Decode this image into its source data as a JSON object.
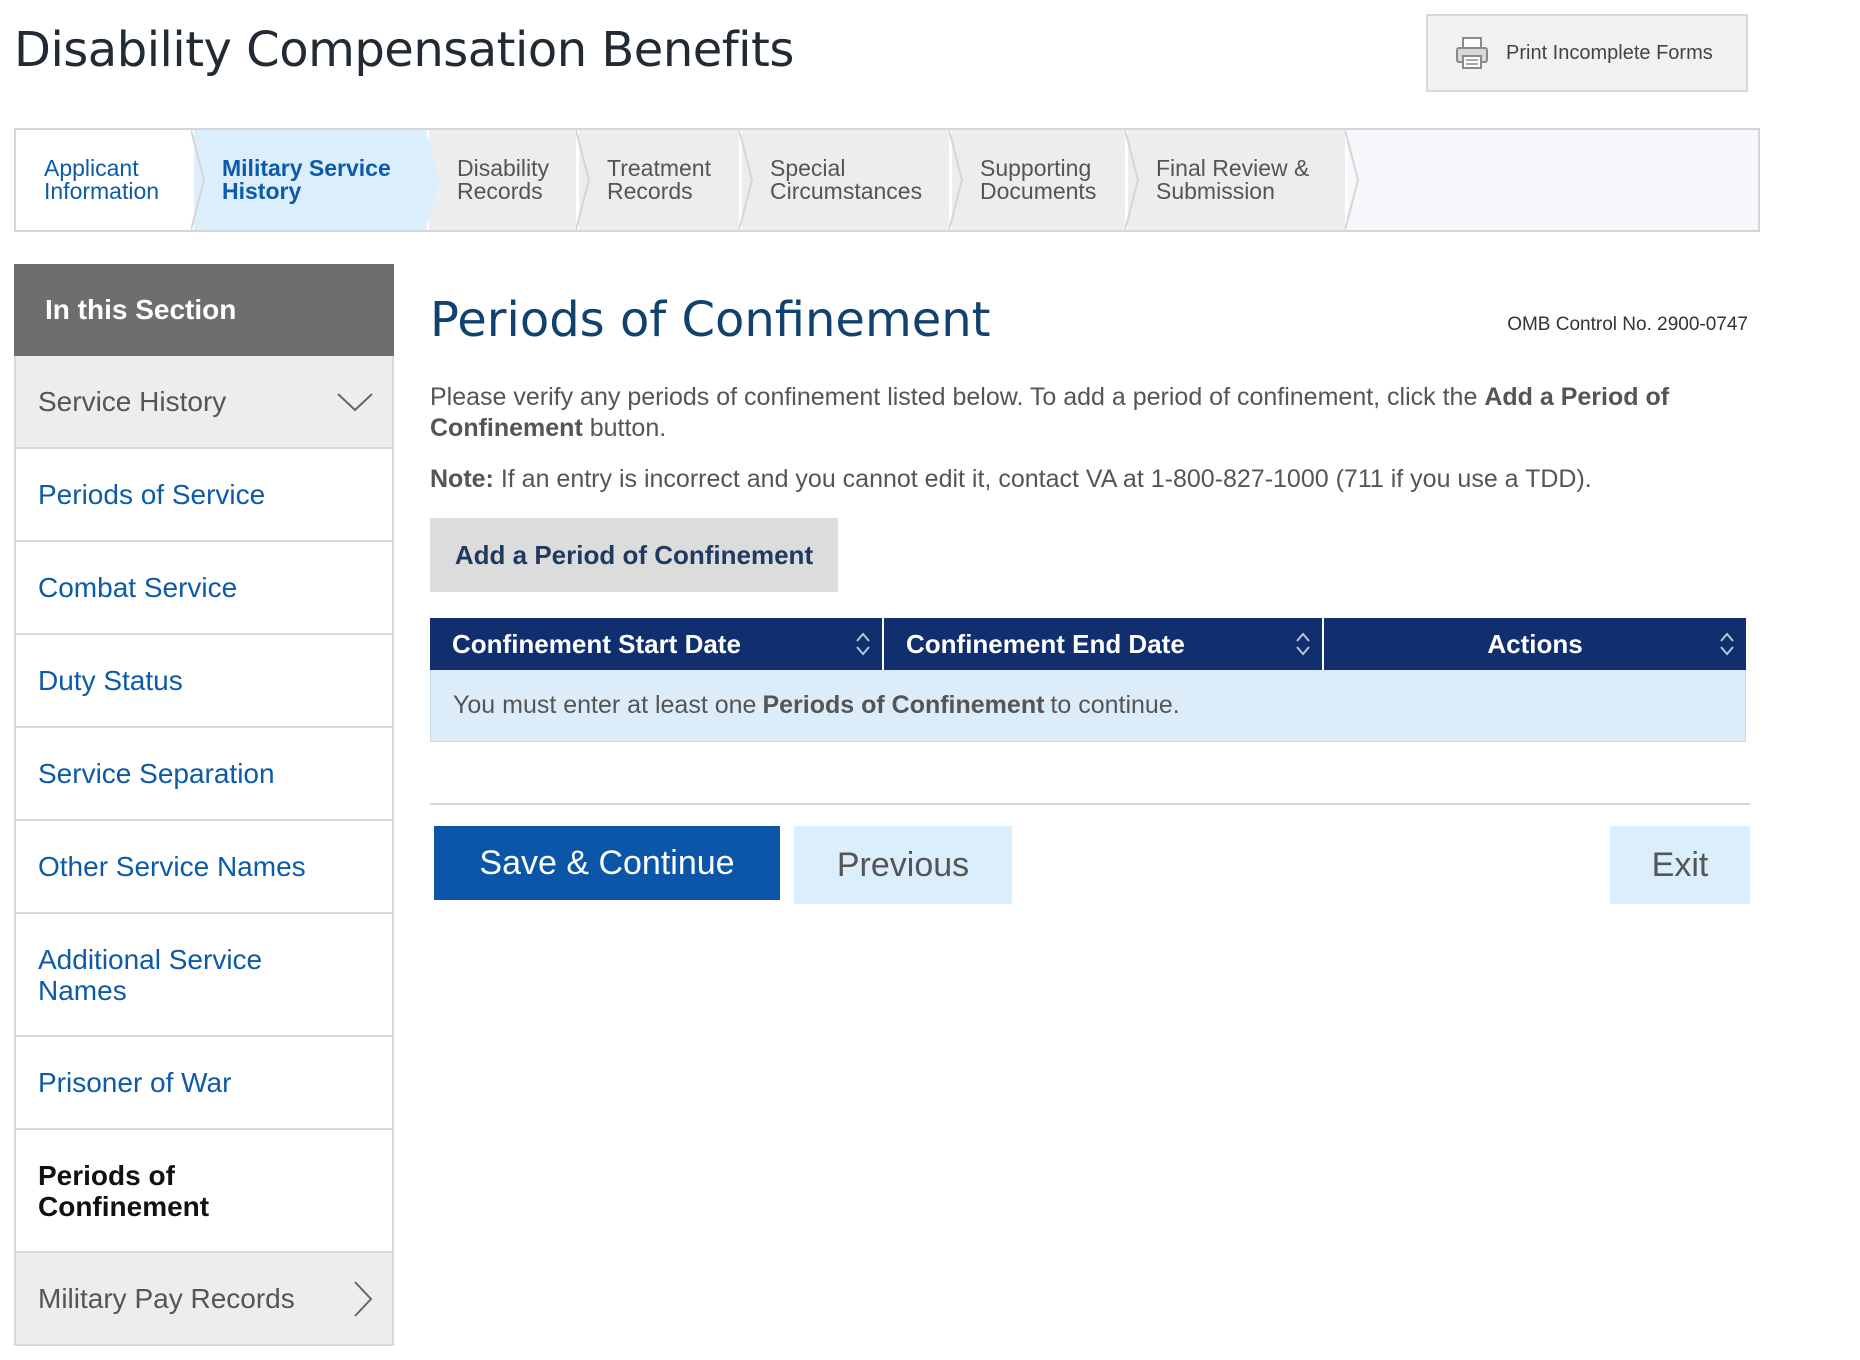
{
  "header": {
    "title": "Disability Compensation Benefits",
    "print_button": "Print Incomplete Forms"
  },
  "steps": [
    {
      "label": "Applicant Information",
      "state": "done"
    },
    {
      "label": "Military Service History",
      "state": "current"
    },
    {
      "label": "Disability Records",
      "state": "upcoming"
    },
    {
      "label": "Treatment Records",
      "state": "upcoming"
    },
    {
      "label": "Special Circumstances",
      "state": "upcoming"
    },
    {
      "label": "Supporting Documents",
      "state": "upcoming"
    },
    {
      "label": "Final Review & Submission",
      "state": "upcoming"
    }
  ],
  "sidebar": {
    "heading": "In this Section",
    "items": [
      {
        "label": "Service History"
      },
      {
        "label": "Periods of Service"
      },
      {
        "label": "Combat Service"
      },
      {
        "label": "Duty Status"
      },
      {
        "label": "Service Separation"
      },
      {
        "label": "Other Service Names"
      },
      {
        "label": "Additional Service Names"
      },
      {
        "label": "Prisoner of War"
      },
      {
        "label": "Periods of Confinement"
      },
      {
        "label": "Military Pay Records"
      }
    ]
  },
  "main": {
    "title": "Periods of Confinement",
    "omb": "OMB Control No. 2900-0747",
    "intro_prefix": "Please verify any periods of confinement listed below. To add a period of confinement, click the ",
    "intro_bold": "Add a Period of Confinement",
    "intro_suffix": " button.",
    "note_label": "Note:",
    "note_text": " If an entry is incorrect and you cannot edit it, contact VA at 1-800-827-1000 (711 if you use a TDD).",
    "add_button": "Add a Period of Confinement",
    "table": {
      "columns": [
        "Confinement Start Date",
        "Confinement End Date",
        "Actions"
      ],
      "empty_prefix": "You must enter at least one ",
      "empty_bold": "Periods of Confinement",
      "empty_suffix": " to continue."
    },
    "save_button": "Save & Continue",
    "previous_button": "Previous",
    "exit_button": "Exit"
  },
  "colors": {
    "brand_blue": "#0b56a8",
    "table_header": "#112e6e",
    "highlight": "#dbeefb"
  }
}
